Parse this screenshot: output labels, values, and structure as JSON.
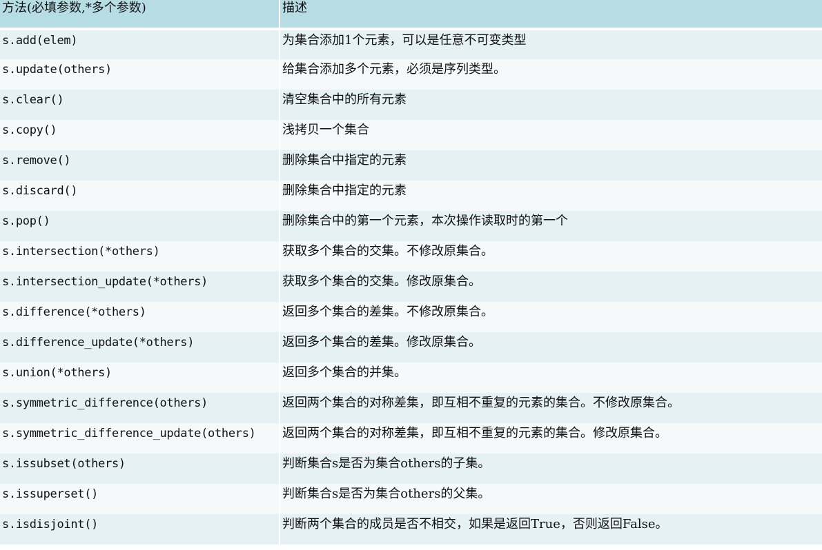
{
  "header": {
    "method": "方法(必填参数,*多个参数)",
    "description": "描述"
  },
  "rows": [
    {
      "method": "s.add(elem)",
      "desc": "为集合添加1个元素，可以是任意不可变类型"
    },
    {
      "method": "s.update(others)",
      "desc": "给集合添加多个元素，必须是序列类型。"
    },
    {
      "method": "s.clear()",
      "desc": "清空集合中的所有元素"
    },
    {
      "method": "s.copy()",
      "desc": "浅拷贝一个集合"
    },
    {
      "method": "s.remove()",
      "desc": "删除集合中指定的元素"
    },
    {
      "method": "s.discard()",
      "desc": "删除集合中指定的元素"
    },
    {
      "method": "s.pop()",
      "desc": "删除集合中的第一个元素，本次操作读取时的第一个"
    },
    {
      "method": "s.intersection(*others)",
      "desc": "获取多个集合的交集。不修改原集合。"
    },
    {
      "method": "s.intersection_update(*others)",
      "desc": "获取多个集合的交集。修改原集合。"
    },
    {
      "method": "s.difference(*others)",
      "desc": "返回多个集合的差集。不修改原集合。"
    },
    {
      "method": "s.difference_update(*others)",
      "desc": "返回多个集合的差集。修改原集合。"
    },
    {
      "method": "s.union(*others)",
      "desc": "返回多个集合的并集。"
    },
    {
      "method": "s.symmetric_difference(others)",
      "desc": "返回两个集合的对称差集，即互相不重复的元素的集合。不修改原集合。"
    },
    {
      "method": "s.symmetric_difference_update(others)",
      "desc": "返回两个集合的对称差集，即互相不重复的元素的集合。修改原集合。"
    },
    {
      "method": "s.issubset(others)",
      "desc": "判断集合s是否为集合others的子集。"
    },
    {
      "method": "s.issuperset()",
      "desc": "判断集合s是否为集合others的父集。"
    },
    {
      "method": "s.isdisjoint()",
      "desc": "判断两个集合的成员是否不相交，如果是返回True，否则返回False。"
    }
  ]
}
